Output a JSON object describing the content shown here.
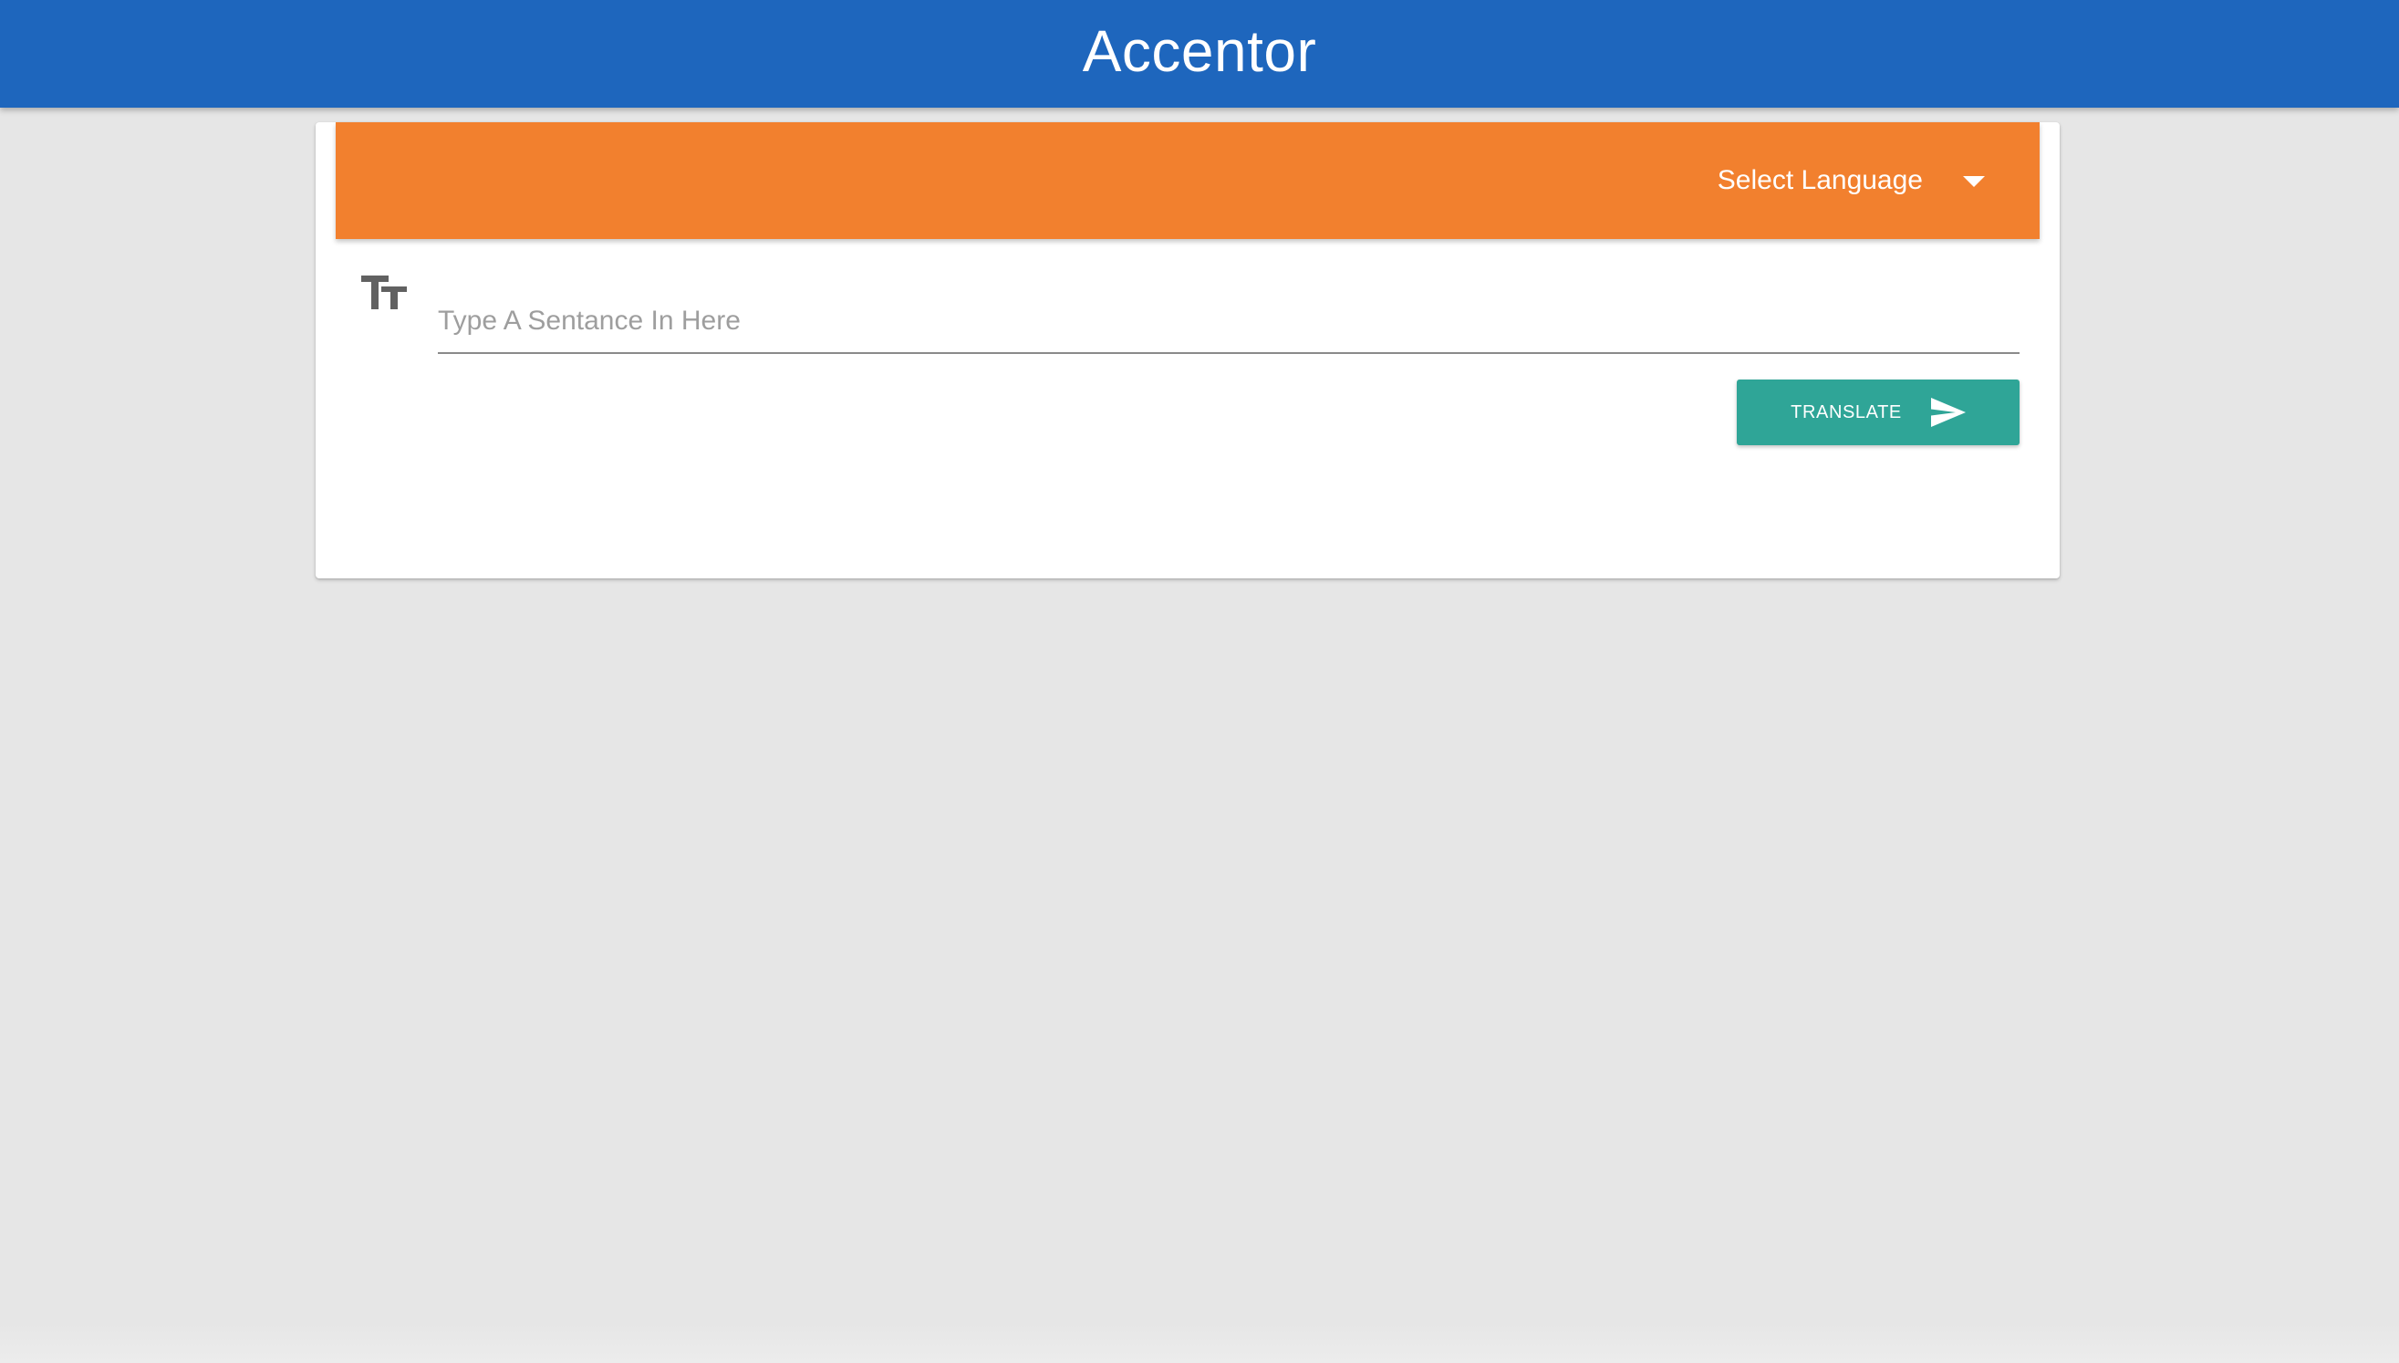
{
  "app": {
    "title": "Accentor"
  },
  "language": {
    "label": "Select Language"
  },
  "input": {
    "placeholder": "Type A Sentance In Here",
    "value": ""
  },
  "actions": {
    "translate_label": "TRANSLATE"
  },
  "icons": {
    "text": "text-fields-icon",
    "caret": "arrow-drop-down-icon",
    "send": "send-icon"
  },
  "colors": {
    "appbar": "#1e66bd",
    "language_bar": "#f2802e",
    "translate_button": "#2fa597",
    "background": "#e6e6e6"
  }
}
